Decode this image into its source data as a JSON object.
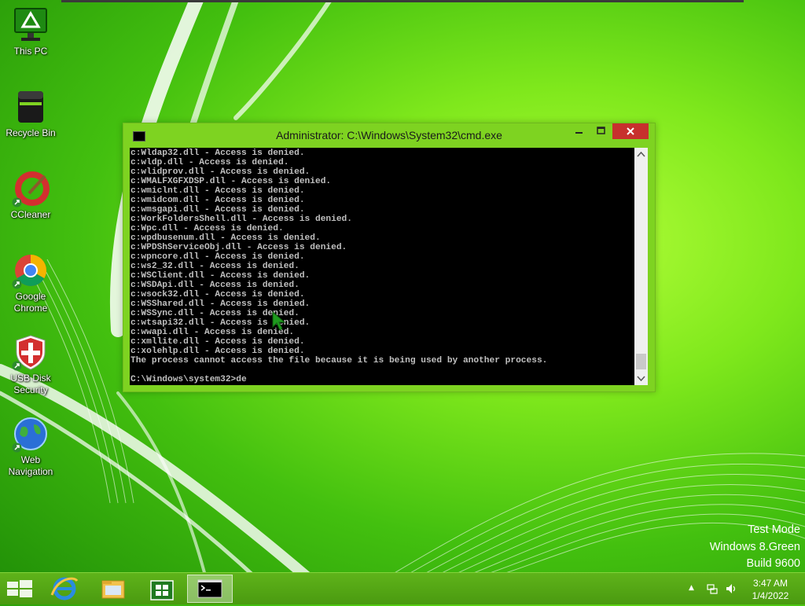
{
  "desktop": {
    "icons": [
      {
        "label": "This PC"
      },
      {
        "label": "Recycle Bin"
      },
      {
        "label": "CCleaner"
      },
      {
        "label": "Google Chrome"
      },
      {
        "label": "USB Disk Security"
      },
      {
        "label": "Web Navigation"
      }
    ]
  },
  "cmd": {
    "title": "Administrator: C:\\Windows\\System32\\cmd.exe",
    "lines": [
      "c:Wldap32.dll - Access is denied.",
      "c:wldp.dll - Access is denied.",
      "c:wlidprov.dll - Access is denied.",
      "c:WMALFXGFXDSP.dll - Access is denied.",
      "c:wmiclnt.dll - Access is denied.",
      "c:wmidcom.dll - Access is denied.",
      "c:wmsgapi.dll - Access is denied.",
      "c:WorkFoldersShell.dll - Access is denied.",
      "c:Wpc.dll - Access is denied.",
      "c:wpdbusenum.dll - Access is denied.",
      "c:WPDShServiceObj.dll - Access is denied.",
      "c:wpncore.dll - Access is denied.",
      "c:ws2_32.dll - Access is denied.",
      "c:WSClient.dll - Access is denied.",
      "c:WSDApi.dll - Access is denied.",
      "c:wsock32.dll - Access is denied.",
      "c:WSShared.dll - Access is denied.",
      "c:WSSync.dll - Access is denied.",
      "c:wtsapi32.dll - Access is denied.",
      "c:wwapi.dll - Access is denied.",
      "c:xmllite.dll - Access is denied.",
      "c:xolehlp.dll - Access is denied.",
      "The process cannot access the file because it is being used by another process.",
      "",
      "C:\\Windows\\system32>de"
    ],
    "text_color": "#c0c0c0"
  },
  "watermark": {
    "line1": "Test Mode",
    "line2": "Windows 8.Green",
    "line3": "Build 9600"
  },
  "taskbar": {
    "items": [
      {
        "icon": "start-icon"
      },
      {
        "icon": "internet-explorer-icon"
      },
      {
        "icon": "file-explorer-icon"
      },
      {
        "icon": "store-icon"
      },
      {
        "icon": "cmd-icon",
        "active": true
      }
    ],
    "clock": {
      "time": "3:47 AM",
      "date": "1/4/2022"
    }
  },
  "colors": {
    "accent": "#7ed321",
    "close_button": "#c7302d",
    "taskbar": "#4a9a10"
  }
}
